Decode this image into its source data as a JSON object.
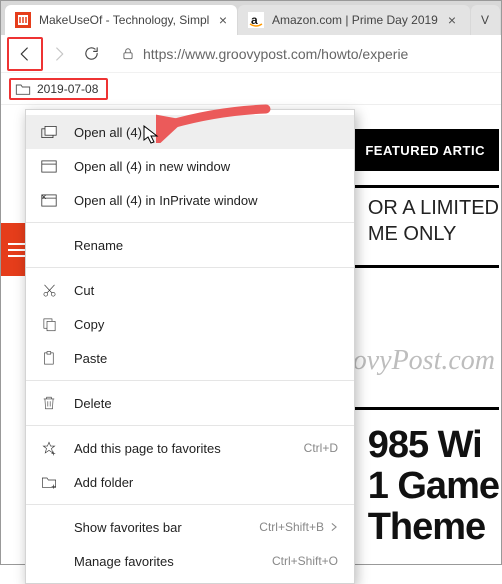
{
  "tabs": [
    {
      "title": "MakeUseOf - Technology, Simpli"
    },
    {
      "title": "Amazon.com | Prime Day 2019"
    },
    {
      "title": "V"
    }
  ],
  "address": {
    "url": "https://www.groovypost.com/howto/experie"
  },
  "favbar": {
    "folder_label": "2019-07-08"
  },
  "page": {
    "featured": "FEATURED ARTIC",
    "promo_line1": "OR A LIMITED",
    "promo_line2": "ME ONLY",
    "watermark": "groovyPost.com",
    "big1": "985 Wi",
    "big2": "1 Game",
    "big3": "Theme"
  },
  "ctx": {
    "open_all": "Open all (4)",
    "open_all_new": "Open all (4) in new window",
    "open_all_priv": "Open all (4) in InPrivate window",
    "rename": "Rename",
    "cut": "Cut",
    "copy": "Copy",
    "paste": "Paste",
    "delete": "Delete",
    "add_page": "Add this page to favorites",
    "add_page_kbd": "Ctrl+D",
    "add_folder": "Add folder",
    "show_favbar": "Show favorites bar",
    "show_favbar_kbd": "Ctrl+Shift+B",
    "manage": "Manage favorites",
    "manage_kbd": "Ctrl+Shift+O"
  }
}
